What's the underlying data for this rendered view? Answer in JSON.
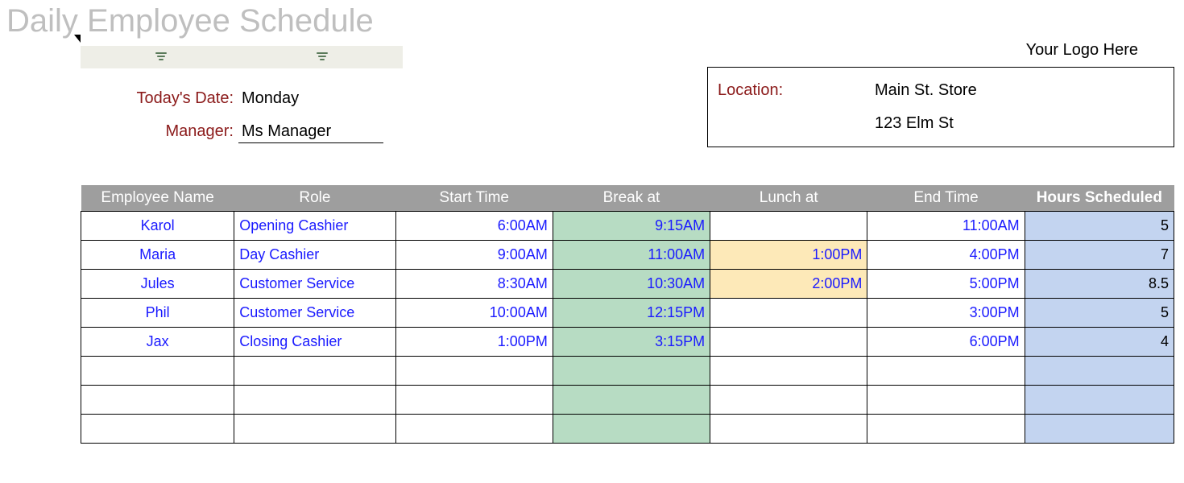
{
  "title": "Daily Employee Schedule",
  "logo_placeholder": "Your Logo Here",
  "info": {
    "date_label": "Today's Date:",
    "date_value": "Monday",
    "manager_label": "Manager:",
    "manager_value": "Ms Manager"
  },
  "location": {
    "label": "Location:",
    "name": "Main St. Store",
    "address": "123 Elm St"
  },
  "columns": {
    "name": "Employee Name",
    "role": "Role",
    "start": "Start Time",
    "break": "Break at",
    "lunch": "Lunch at",
    "end": "End Time",
    "hours": "Hours Scheduled"
  },
  "rows": [
    {
      "name": "Karol",
      "role": "Opening Cashier",
      "start": "6:00AM",
      "break": "9:15AM",
      "lunch": "",
      "end": "11:00AM",
      "hours": "5"
    },
    {
      "name": "Maria",
      "role": "Day Cashier",
      "start": "9:00AM",
      "break": "11:00AM",
      "lunch": "1:00PM",
      "end": "4:00PM",
      "hours": "7"
    },
    {
      "name": "Jules",
      "role": "Customer Service",
      "start": "8:30AM",
      "break": "10:30AM",
      "lunch": "2:00PM",
      "end": "5:00PM",
      "hours": "8.5"
    },
    {
      "name": "Phil",
      "role": "Customer Service",
      "start": "10:00AM",
      "break": "12:15PM",
      "lunch": "",
      "end": "3:00PM",
      "hours": "5"
    },
    {
      "name": "Jax",
      "role": "Closing Cashier",
      "start": "1:00PM",
      "break": "3:15PM",
      "lunch": "",
      "end": "6:00PM",
      "hours": "4"
    }
  ],
  "empty_rows": 3
}
